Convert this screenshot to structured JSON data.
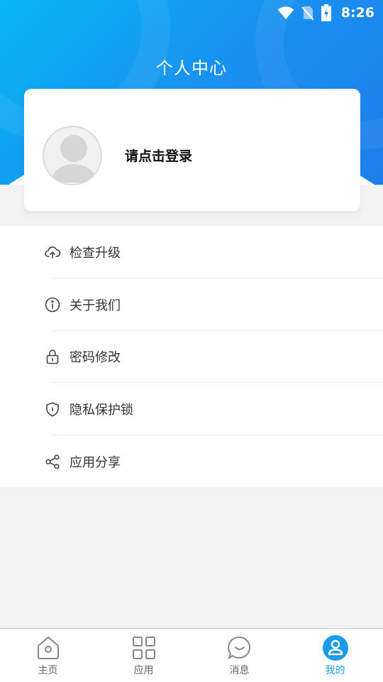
{
  "status_bar": {
    "time": "8:26",
    "icons": [
      "wifi-icon",
      "no-sim-icon",
      "battery-charging-icon"
    ]
  },
  "header": {
    "title": "个人中心"
  },
  "profile": {
    "login_prompt": "请点击登录",
    "avatar": "default-avatar-icon"
  },
  "menu": {
    "items": [
      {
        "label": "检查升级",
        "icon": "cloud-upload-icon"
      },
      {
        "label": "关于我们",
        "icon": "info-icon"
      },
      {
        "label": "密码修改",
        "icon": "lock-icon"
      },
      {
        "label": "隐私保护锁",
        "icon": "shield-icon"
      },
      {
        "label": "应用分享",
        "icon": "share-icon"
      }
    ]
  },
  "bottom_nav": {
    "items": [
      {
        "label": "主页",
        "icon": "home-icon",
        "active": false
      },
      {
        "label": "应用",
        "icon": "grid-icon",
        "active": false
      },
      {
        "label": "消息",
        "icon": "message-icon",
        "active": false
      },
      {
        "label": "我的",
        "icon": "profile-icon",
        "active": true
      }
    ]
  },
  "colors": {
    "accent": "#1a9be8",
    "header_gradient_start": "#06b6f3",
    "header_gradient_end": "#1d7eea",
    "page_background": "#f3f3f3"
  }
}
